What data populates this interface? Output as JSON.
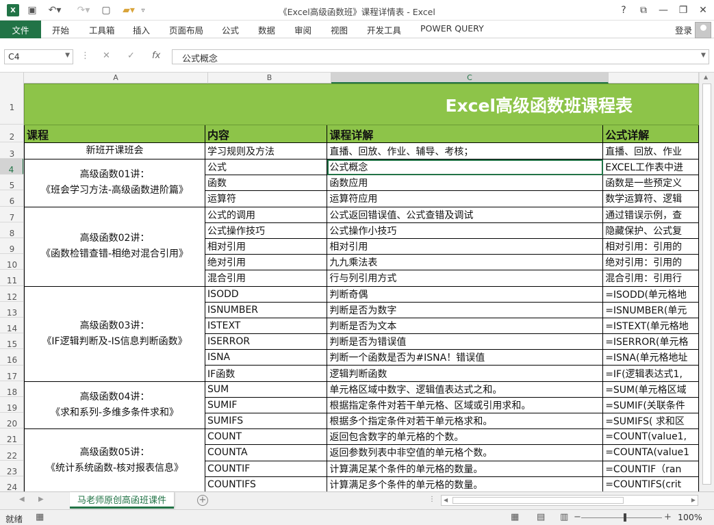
{
  "window": {
    "title": "《Excel高级函数班》课程详情表 - Excel",
    "help": "?",
    "minimize": "—",
    "restore": "❐",
    "close": "✕"
  },
  "ribbon": {
    "file": "文件",
    "tabs": [
      "开始",
      "工具箱",
      "插入",
      "页面布局",
      "公式",
      "数据",
      "审阅",
      "视图",
      "开发工具",
      "POWER QUERY"
    ],
    "login": "登录"
  },
  "formula_bar": {
    "name_box": "C4",
    "content": "公式概念",
    "fx": "fx"
  },
  "columns": [
    "A",
    "B",
    "C"
  ],
  "rows": [
    "1",
    "2",
    "3",
    "4",
    "5",
    "6",
    "7",
    "8",
    "9",
    "10",
    "11",
    "12",
    "13",
    "14",
    "15",
    "16",
    "17",
    "18",
    "19",
    "20",
    "21",
    "22",
    "23",
    "24"
  ],
  "sheet": {
    "title": "Excel高级函数班课程表",
    "headers": [
      "课程",
      "内容",
      "课程详解",
      "公式详解"
    ],
    "groups": [
      {
        "course_line1": "新班开课班会",
        "course_line2": "",
        "items": [
          [
            "学习规则及方法",
            "直播、回放、作业、辅导、考核；",
            "直播、回放、作业"
          ]
        ]
      },
      {
        "course_line1": "高级函数01讲：",
        "course_line2": "《班会学习方法-高级函数进阶篇》",
        "items": [
          [
            "公式",
            "公式概念",
            "EXCEL工作表中进"
          ],
          [
            "函数",
            "函数应用",
            "函数是一些预定义"
          ],
          [
            "运算符",
            "运算符应用",
            "数学运算符、逻辑"
          ]
        ]
      },
      {
        "course_line1": "高级函数02讲：",
        "course_line2": "《函数检错查错-相绝对混合引用》",
        "items": [
          [
            "公式的调用",
            "公式返回错误值、公式查错及调试",
            "通过错误示例，查"
          ],
          [
            "公式操作技巧",
            "公式操作小技巧",
            "隐藏保护、公式复"
          ],
          [
            "相对引用",
            "相对引用",
            "相对引用：引用的"
          ],
          [
            "绝对引用",
            "九九乘法表",
            "绝对引用：引用的"
          ],
          [
            "混合引用",
            "行与列引用方式",
            "混合引用：引用行"
          ]
        ]
      },
      {
        "course_line1": "高级函数03讲：",
        "course_line2": "《IF逻辑判断及-IS信息判断函数》",
        "items": [
          [
            "ISODD",
            "判断奇偶",
            " =ISODD(单元格地"
          ],
          [
            "ISNUMBER",
            "判断是否为数字",
            " =ISNUMBER(单元"
          ],
          [
            "ISTEXT",
            "判断是否为文本",
            " =ISTEXT(单元格地"
          ],
          [
            "ISERROR",
            "判断是否为错误值",
            " =ISERROR(单元格"
          ],
          [
            "ISNA",
            "判断一个函数是否为#ISNA！错误值",
            " =ISNA(单元格地址"
          ],
          [
            "IF函数",
            "逻辑判断函数",
            " =IF(逻辑表达式1,"
          ]
        ]
      },
      {
        "course_line1": "高级函数04讲：",
        "course_line2": "《求和系列-多维多条件求和》",
        "items": [
          [
            "SUM",
            "单元格区域中数字、逻辑值表达式之和。",
            " =SUM(单元格区域"
          ],
          [
            "SUMIF",
            "根据指定条件对若干单元格、区域或引用求和。",
            " =SUMIF(关联条件"
          ],
          [
            "SUMIFS",
            "根据多个指定条件对若干单元格求和。",
            " =SUMIFS( 求和区"
          ]
        ]
      },
      {
        "course_line1": "高级函数05讲：",
        "course_line2": "《统计系统函数-核对报表信息》",
        "items": [
          [
            "COUNT",
            "返回包含数字的单元格的个数。",
            " =COUNT(value1,"
          ],
          [
            "COUNTA",
            "返回参数列表中非空值的单元格个数。",
            " =COUNTA(value1"
          ],
          [
            "COUNTIF",
            "计算满足某个条件的单元格的数量。",
            " =COUNTIF（ran"
          ],
          [
            "COUNTIFS",
            "计算满足多个条件的单元格的数量。",
            " =COUNTIFS(crit"
          ]
        ]
      }
    ]
  },
  "sheet_tab": "马老师原创高函班课件",
  "status": {
    "ready": "就绪",
    "zoom": "100%"
  },
  "colors": {
    "excel_green": "#217346",
    "header_green": "#8dc449"
  }
}
